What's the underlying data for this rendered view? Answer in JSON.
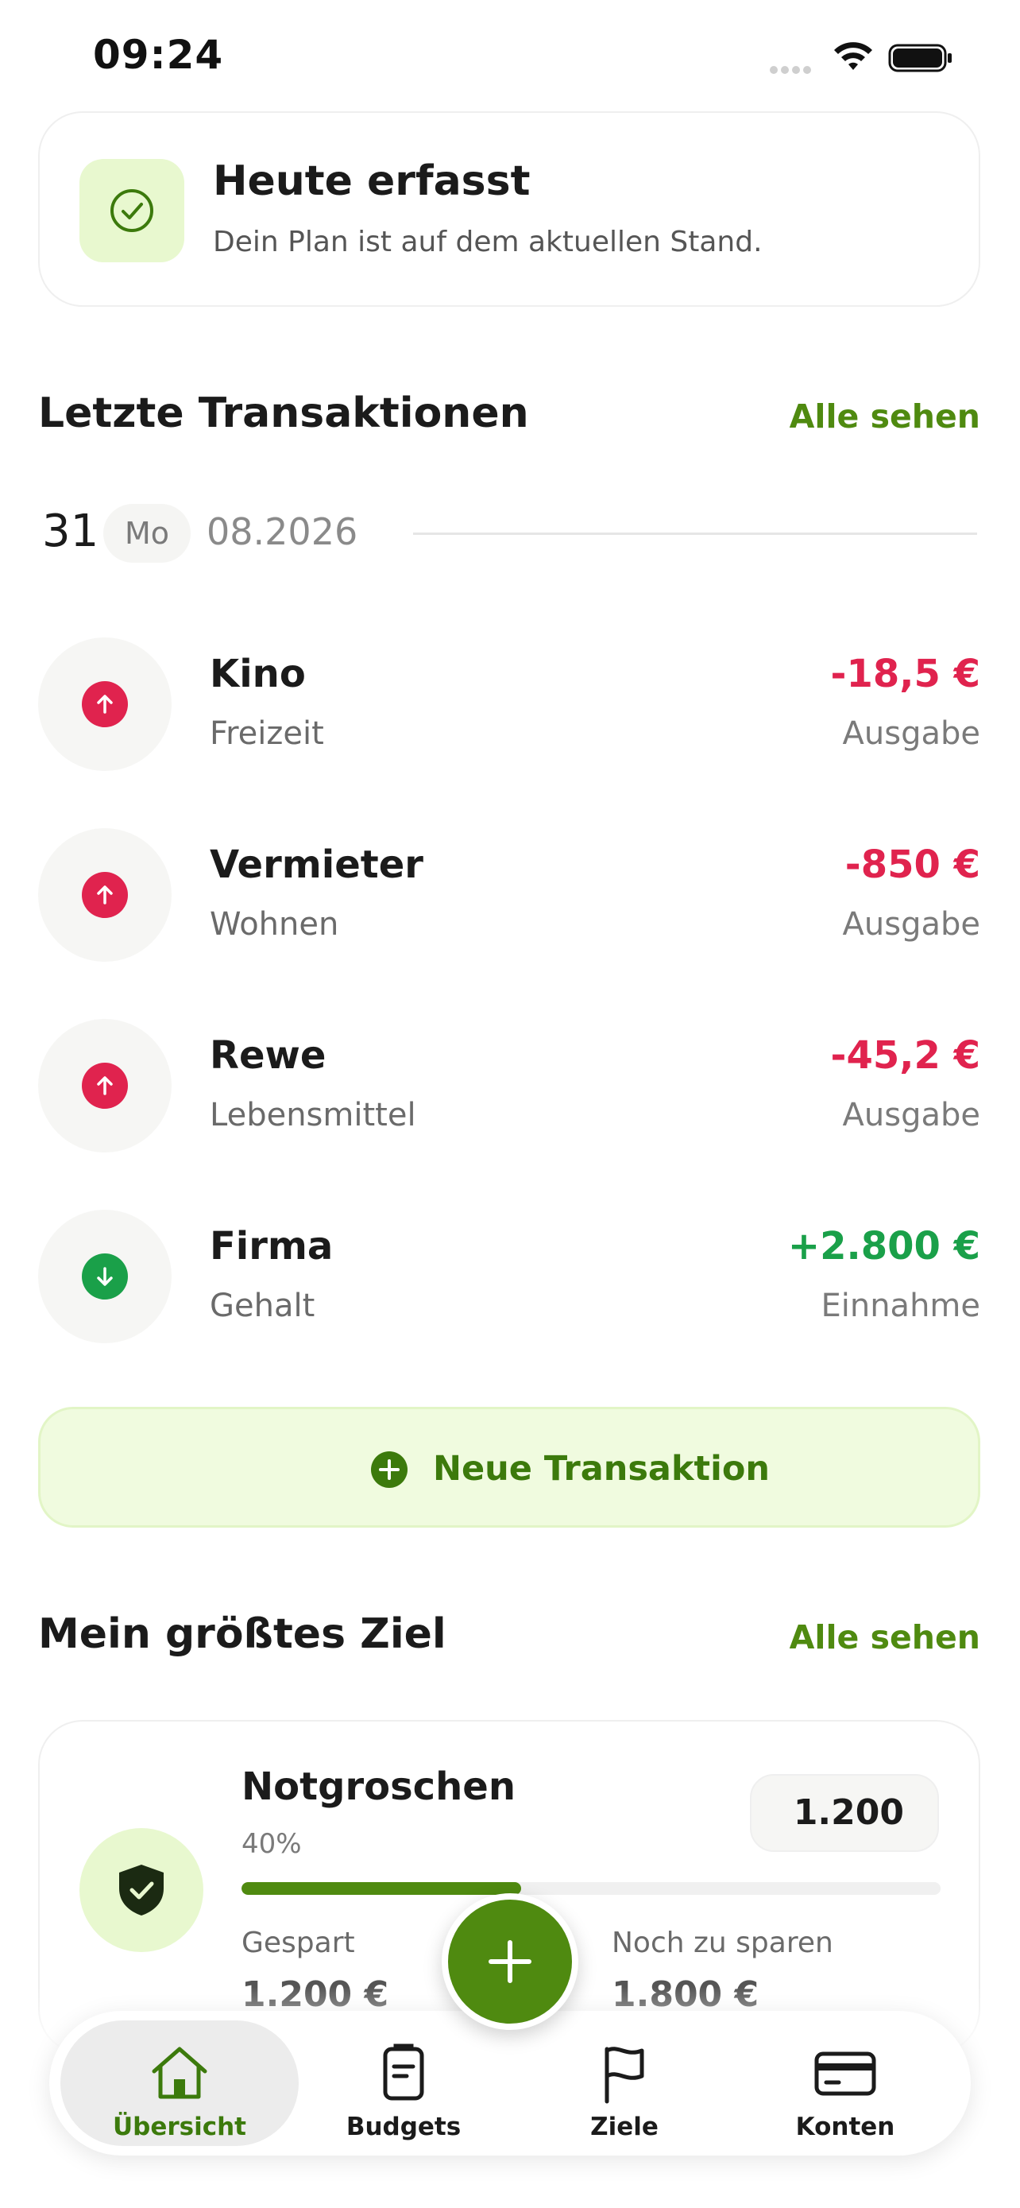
{
  "status_bar": {
    "time": "09:24"
  },
  "today_card": {
    "title": "Heute erfasst",
    "subtitle": "Dein Plan ist auf dem aktuellen Stand.",
    "icon": "check-circle-icon"
  },
  "transactions": {
    "title": "Letzte Transaktionen",
    "see_all": "Alle sehen",
    "date": {
      "day": "31",
      "weekday": "Mo",
      "month_year": "08.2026"
    },
    "items": [
      {
        "name": "Kino",
        "category": "Freizeit",
        "amount": "-18,5 €",
        "type": "Ausgabe",
        "direction": "out"
      },
      {
        "name": "Vermieter",
        "category": "Wohnen",
        "amount": "-850 €",
        "type": "Ausgabe",
        "direction": "out"
      },
      {
        "name": "Rewe",
        "category": "Lebensmittel",
        "amount": "-45,2 €",
        "type": "Ausgabe",
        "direction": "out"
      },
      {
        "name": "Firma",
        "category": "Gehalt",
        "amount": "+2.800 €",
        "type": "Einnahme",
        "direction": "in"
      }
    ],
    "new_button": "Neue Transaktion"
  },
  "goal": {
    "title": "Mein größtes Ziel",
    "see_all": "Alle sehen",
    "name": "Notgroschen",
    "percent_label": "40%",
    "progress": 0.4,
    "target": "1.200",
    "saved_label": "Gespart",
    "saved_value": "1.200 €",
    "remaining_label": "Noch zu sparen",
    "remaining_value": "1.800 €",
    "icon": "shield-check-icon"
  },
  "tab_bar": {
    "tabs": [
      {
        "label": "Übersicht",
        "icon": "home-icon",
        "active": true
      },
      {
        "label": "Budgets",
        "icon": "clipboard-icon",
        "active": false
      },
      {
        "label": "Ziele",
        "icon": "flag-icon",
        "active": false
      },
      {
        "label": "Konten",
        "icon": "card-icon",
        "active": false
      }
    ]
  },
  "colors": {
    "accent": "#4f8a10",
    "expense": "#e0234e",
    "income": "#1aa049",
    "light_green": "#e8f8cf"
  }
}
